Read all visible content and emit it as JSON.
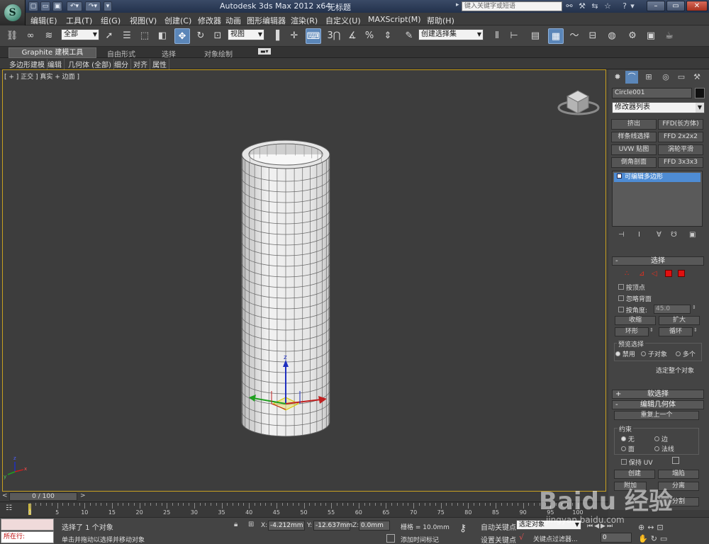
{
  "app": {
    "title": "Autodesk 3ds Max  2012 x64",
    "file": "无标题",
    "logo_letter": "S"
  },
  "search": {
    "placeholder": "键入关键字或短语"
  },
  "menu": [
    "编辑(E)",
    "工具(T)",
    "组(G)",
    "视图(V)",
    "创建(C)",
    "修改器",
    "动画",
    "图形编辑器",
    "渲染(R)",
    "自定义(U)",
    "MAXScript(M)",
    "帮助(H)"
  ],
  "toolbar": {
    "selection_filter": "全部",
    "ref_coord": "视图",
    "named_selection": "创建选择集"
  },
  "ribbon": {
    "tabs": [
      "Graphite 建模工具",
      "自由形式",
      "选择",
      "对象绘制"
    ],
    "sub": [
      "多边形建模",
      "编辑",
      "几何体 (全部)",
      "细分",
      "对齐",
      "属性"
    ]
  },
  "viewport": {
    "label": "[ + ] 正交 ] 真实 + 边面 ]"
  },
  "cmd": {
    "object_name": "Circle001",
    "modifier_list": "修改器列表",
    "mod_buttons": [
      "挤出",
      "FFD(长方体)",
      "样条线选择",
      "FFD 2x2x2",
      "UVW 贴图",
      "涡轮平滑",
      "倒角剖面",
      "FFD 3x3x3"
    ],
    "stack_item": "可编辑多边形",
    "selection": {
      "title": "选择",
      "by_vertex": "按顶点",
      "ignore_backface": "忽略背面",
      "by_angle": "按角度:",
      "angle_value": "45.0",
      "shrink": "收缩",
      "grow": "扩大",
      "ring": "环形",
      "loop": "循环",
      "preview": "预览选择",
      "preview_off": "禁用",
      "preview_sub": "子对象",
      "preview_multi": "多个",
      "whole_object": "选定整个对象"
    },
    "soft_selection": "软选择",
    "edit_geometry": {
      "title": "编辑几何体",
      "repeat_last": "重复上一个",
      "constraints": "约束",
      "none": "无",
      "edge": "边",
      "face": "面",
      "normal": "法线",
      "preserve_uv": "保持 UV",
      "create": "创建",
      "collapse": "塌陷",
      "attach": "附加",
      "detach": "分离",
      "slice": "分割"
    }
  },
  "timeline": {
    "slider": "0 / 100",
    "ticks": [
      "0",
      "5",
      "10",
      "15",
      "20",
      "25",
      "30",
      "35",
      "40",
      "45",
      "50",
      "55",
      "60",
      "65",
      "70",
      "75",
      "80",
      "85",
      "90",
      "95",
      "100"
    ]
  },
  "status": {
    "script_label": "所在行:",
    "selected": "选择了 1 个对象",
    "hint": "单击并拖动以选择并移动对象",
    "x_label": "X:",
    "x": "-4.212mm",
    "y_label": "Y:",
    "y": "-12.637mm",
    "z_label": "Z:",
    "z": "0.0mm",
    "grid": "栅格 = 10.0mm",
    "add_time_tag": "添加时间标记",
    "auto_key": "自动关键点",
    "set_key": "设置关键点",
    "key_mode": "选定对象",
    "key_filters": "关键点过滤器...",
    "frame": "0"
  },
  "colors": {
    "accent": "#5b86b8",
    "viewport_border": "#c8a020"
  },
  "watermark": {
    "brand": "Baidu 经验",
    "url": "jingyan.baidu.com"
  }
}
